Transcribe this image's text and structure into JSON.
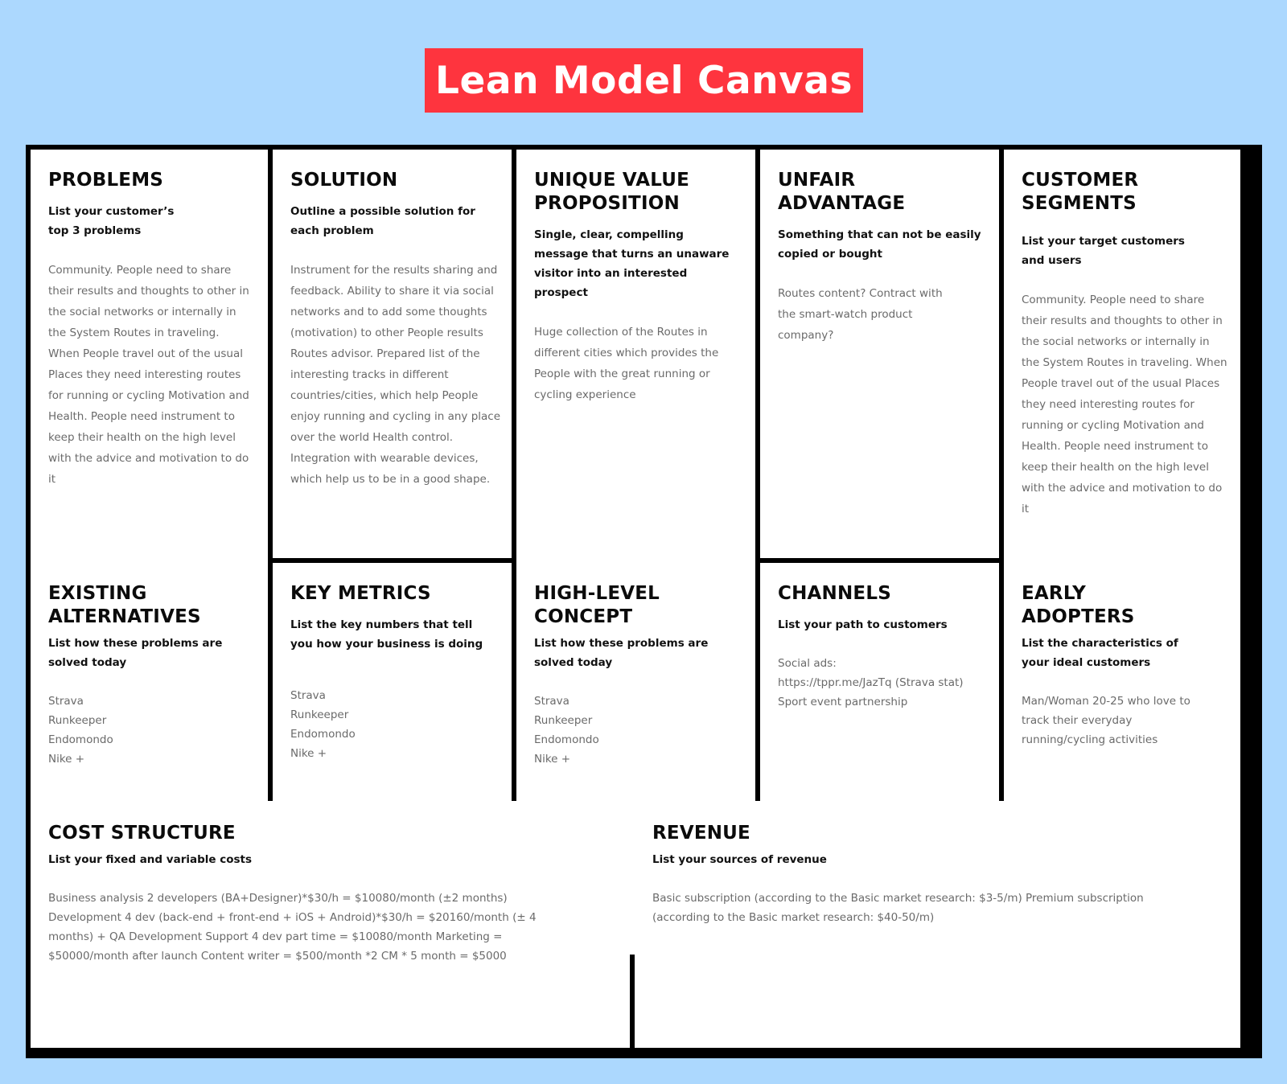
{
  "title": "Lean Model Canvas",
  "colors": {
    "background": "#acd8fe",
    "title_badge": "#fe343e",
    "title_text": "#ffffff",
    "grid_lines": "#000000",
    "heading_text": "#0b0b0b",
    "body_text": "#6a6a6a"
  },
  "sections": {
    "problems": {
      "heading": "PROBLEMS",
      "subheading": "List your customer’s top 3 problems",
      "body": "Community. People need to share their results and thoughts to other in the social networks or internally in the System Routes in traveling. When People travel out of the usual Places they need interesting routes for running or cycling Motivation and Health. People need instrument to keep their health on the high level with the advice and motivation to do it"
    },
    "solution": {
      "heading": "SOLUTION",
      "subheading": "Outline a possible solution  for each problem",
      "body": "Instrument for the results sharing and feedback. Ability to share it via social networks and to add some thoughts (motivation) to other People results Routes advisor. Prepared list of the interesting tracks in different countries/cities, which help People enjoy running and cycling in any place over the world Health control. Integration with wearable devices, which help us to be in a good shape."
    },
    "unique_value_proposition": {
      "heading": "UNIQUE VALUE PROPOSITION",
      "subheading": "Single, clear, compelling message that turns an unaware visitor into an interested prospect",
      "body": "Huge collection of the Routes in different cities which provides the People with the great running or cycling experience"
    },
    "unfair_advantage": {
      "heading": "UNFAIR ADVANTAGE",
      "subheading": "Something that can not be easily copied or bought",
      "body": "Routes content?  Contract with the smart-watch product company?"
    },
    "customer_segments": {
      "heading": "CUSTOMER SEGMENTS",
      "subheading": "List your target customers and users",
      "body": "Community. People need to share their results and thoughts to other in the social networks or internally in the System Routes in traveling. When People travel out of the usual Places they need interesting routes for running or cycling Motivation and Health. People need instrument to keep their health on the high level with the advice and motivation to do it"
    },
    "existing_alternatives": {
      "heading": "EXISTING ALTERNATIVES",
      "subheading": "List how these problems are solved today",
      "items": [
        "Strava",
        "Runkeeper",
        "Endomondo",
        "Nike +"
      ]
    },
    "key_metrics": {
      "heading": "KEY METRICS",
      "subheading": "List the key numbers that tell you how your business is doing",
      "items": [
        "Strava",
        "Runkeeper",
        "Endomondo",
        "Nike +"
      ]
    },
    "high_level_concept": {
      "heading": "HIGH-LEVEL CONCEPT",
      "subheading": "List how these problems are solved today",
      "items": [
        "Strava",
        "Runkeeper",
        "Endomondo",
        "Nike +"
      ]
    },
    "channels": {
      "heading": "CHANNELS",
      "subheading": "List your path to customers",
      "items": [
        "Social ads:",
        "https://tppr.me/JazTq (Strava stat)",
        "Sport event partnership"
      ]
    },
    "early_adopters": {
      "heading": "EARLY ADOPTERS",
      "subheading": "List the characteristics of your ideal customers",
      "body": "Man/Woman 20-25 who love to track their everyday running/cycling activities"
    },
    "cost_structure": {
      "heading": "COST STRUCTURE",
      "subheading": "List your fixed and variable costs",
      "body": "Business analysis 2 developers (BA+Designer)*$30/h = $10080/month (±2 months) Development 4 dev (back-end + front-end + iOS + Android)*$30/h = $20160/month (± 4 months) + QA Development Support 4 dev part time = $10080/month Marketing = $50000/month after launch  Content writer = $500/month *2 CM * 5 month = $5000"
    },
    "revenue": {
      "heading": "REVENUE",
      "subheading": "List your sources of revenue",
      "body": "Basic subscription (according to the Basic market research: $3-5/m) Premium subscription (according to the Basic market research: $40-50/m)"
    }
  }
}
